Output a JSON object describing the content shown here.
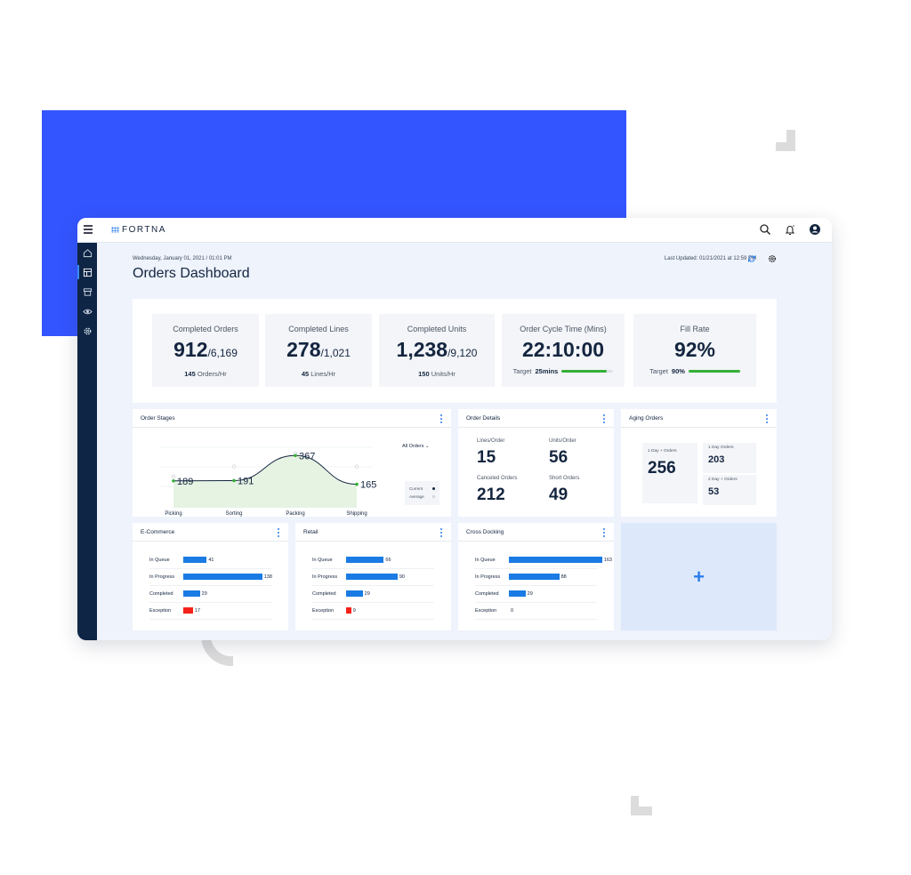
{
  "app": {
    "logo_text": "FORTNA",
    "menu_icon": "hamburger-icon"
  },
  "topbar": {
    "icons": [
      "search-icon",
      "bell-icon",
      "account-icon"
    ]
  },
  "sidebar": {
    "items": [
      {
        "icon": "home-icon",
        "active": false
      },
      {
        "icon": "dashboard-icon",
        "active": true
      },
      {
        "icon": "archive-icon",
        "active": false
      },
      {
        "icon": "eye-icon",
        "active": false
      },
      {
        "icon": "gear-icon",
        "active": false
      }
    ]
  },
  "header": {
    "date": "Wednesday, January 01, 2021  /  01:01 PM",
    "title": "Orders Dashboard",
    "last_updated": "Last Updated: 01/21/2021 at 12:59 PM"
  },
  "kpis": [
    {
      "label": "Completed Orders",
      "value": "912",
      "total": "/6,169",
      "rate_value": "145",
      "rate_unit": "Orders/Hr"
    },
    {
      "label": "Completed Lines",
      "value": "278",
      "total": "/1,021",
      "rate_value": "45",
      "rate_unit": "Lines/Hr"
    },
    {
      "label": "Completed Units",
      "value": "1,238",
      "total": "/9,120",
      "rate_value": "150",
      "rate_unit": "Units/Hr"
    },
    {
      "label": "Order Cycle Time (Mins)",
      "value": "22:10:00",
      "target_label": "Target",
      "target_value": "25mins",
      "progress": 0.88
    },
    {
      "label": "Fill Rate",
      "value": "92%",
      "target_label": "Target",
      "target_value": "90%",
      "progress": 1.0
    }
  ],
  "order_stages": {
    "title": "Order Stages",
    "filter": "All Orders",
    "legend_current": "Current",
    "legend_average": "Average",
    "chart_data": {
      "type": "line",
      "categories": [
        "Picking",
        "Sorting",
        "Packing",
        "Shipping"
      ],
      "series": [
        {
          "name": "Current",
          "values": [
            189,
            191,
            367,
            165
          ]
        },
        {
          "name": "Average",
          "values": [
            220,
            290,
            380,
            290
          ]
        }
      ],
      "value_labels": [
        "189",
        "191",
        "367",
        "165"
      ],
      "ylim": [
        0,
        500
      ],
      "colors": {
        "line": "#14253f",
        "points": "#36b037",
        "fill": "#e6f3e3",
        "average": "#c8ccd2"
      }
    }
  },
  "order_details": {
    "title": "Order Details",
    "items": [
      {
        "label": "Lines/Order",
        "value": "15"
      },
      {
        "label": "Units/Order",
        "value": "56"
      },
      {
        "label": "Canceled Orders",
        "value": "212"
      },
      {
        "label": "Short Orders",
        "value": "49"
      }
    ]
  },
  "aging_orders": {
    "title": "Aging Orders",
    "main_label": "1 Day + Orders",
    "main_value": "256",
    "small": [
      {
        "label": "1 Day Orders",
        "value": "203"
      },
      {
        "label": "2 Day + Orders",
        "value": "53"
      }
    ]
  },
  "bar_cards": [
    {
      "title": "E-Commerce",
      "rows": [
        {
          "label": "In Queue",
          "value": 41,
          "color": "#1a7be4"
        },
        {
          "label": "In Progress",
          "value": 138,
          "color": "#1a7be4"
        },
        {
          "label": "Completed",
          "value": 29,
          "color": "#1a7be4"
        },
        {
          "label": "Exception",
          "value": 17,
          "color": "#f4221a"
        }
      ]
    },
    {
      "title": "Retail",
      "rows": [
        {
          "label": "In Queue",
          "value": 66,
          "color": "#1a7be4"
        },
        {
          "label": "In Progress",
          "value": 90,
          "color": "#1a7be4"
        },
        {
          "label": "Completed",
          "value": 29,
          "color": "#1a7be4"
        },
        {
          "label": "Exception",
          "value": 9,
          "color": "#f4221a"
        }
      ]
    },
    {
      "title": "Cross Docking",
      "rows": [
        {
          "label": "In Queue",
          "value": 163,
          "color": "#1a7be4"
        },
        {
          "label": "In Progress",
          "value": 88,
          "color": "#1a7be4"
        },
        {
          "label": "Completed",
          "value": 29,
          "color": "#1a7be4"
        },
        {
          "label": "Exception",
          "value": 0,
          "color": "#f4221a"
        }
      ]
    }
  ],
  "add_widget": {
    "symbol": "+"
  }
}
